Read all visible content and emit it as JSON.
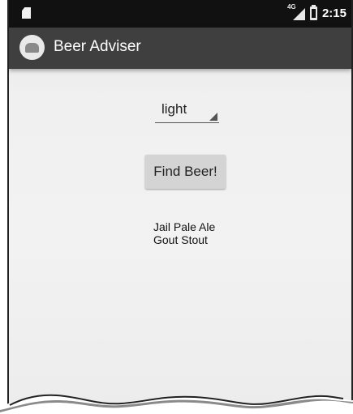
{
  "status_bar": {
    "network": "4G",
    "time": "2:15"
  },
  "app_bar": {
    "title": "Beer Adviser"
  },
  "spinner": {
    "selected": "light"
  },
  "find_button": {
    "label": "Find Beer!"
  },
  "brands": [
    "Jail Pale Ale",
    "Gout Stout"
  ],
  "icons": [
    "sd-card-icon",
    "signal-icon",
    "battery-icon",
    "app-launcher-icon",
    "spinner-dropdown-icon"
  ],
  "colors": {
    "status_bar": "#111111",
    "app_bar": "#3f3f3f",
    "button": "#d4d4d4",
    "background": "#f0f0f0"
  }
}
